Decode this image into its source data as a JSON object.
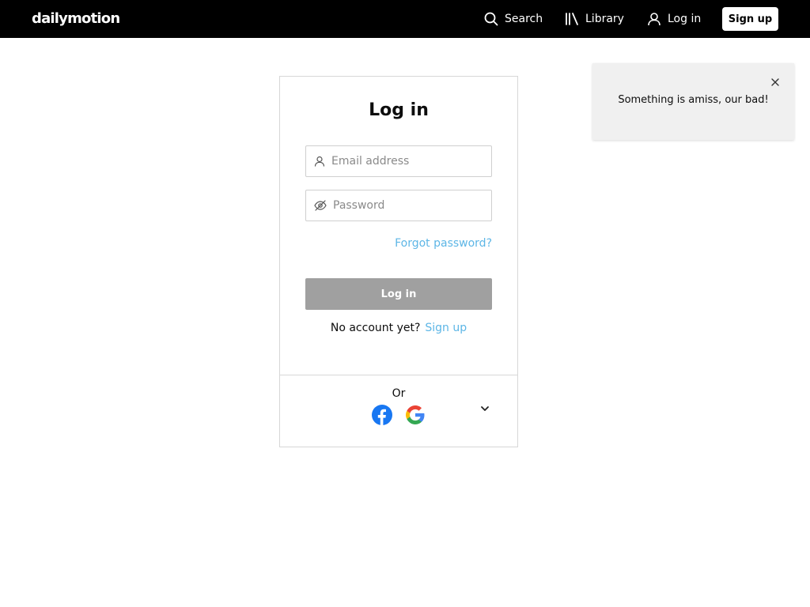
{
  "header": {
    "logo": "dailymotion",
    "search_label": "Search",
    "library_label": "Library",
    "login_label": "Log in",
    "signup_label": "Sign up",
    "icons": [
      "search-icon",
      "library-icon",
      "user-icon"
    ]
  },
  "login_form": {
    "title": "Log in",
    "email_placeholder": "Email address",
    "email_value": "",
    "password_placeholder": "Password",
    "password_value": "",
    "forgot_label": "Forgot password?",
    "submit_label": "Log in",
    "no_account_text": "No account yet?",
    "signup_link": "Sign up",
    "or_label": "Or",
    "social_providers": [
      "Facebook",
      "Google"
    ]
  },
  "toast": {
    "message": "Something is amiss, our bad!"
  },
  "colors": {
    "header_bg": "#000000",
    "link": "#5db6e6",
    "disabled_button": "#a0a0a0",
    "facebook": "#1877f2",
    "toast_bg": "#f0f0f0"
  }
}
